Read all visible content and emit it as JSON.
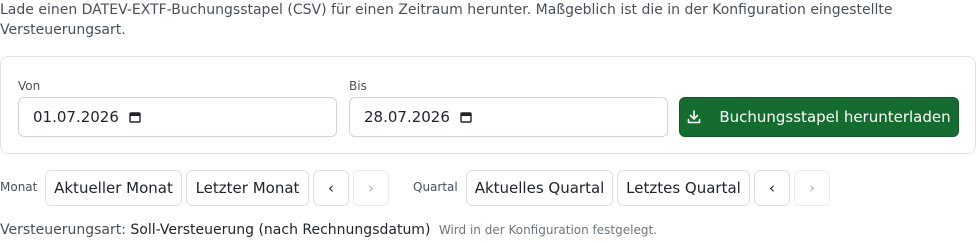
{
  "description": "Lade einen DATEV-EXTF-Buchungsstapel (CSV) für einen Zeitraum herunter. Maßgeblich ist die in der Konfiguration eingestellte Versteuerungsart.",
  "form": {
    "from_label": "Von",
    "from_value": "01.07.2026",
    "to_label": "Bis",
    "to_value": "28.07.2026",
    "download_label": "Buchungsstapel herunterladen"
  },
  "presets": {
    "month_label": "Monat",
    "current_month": "Aktueller Monat",
    "last_month": "Letzter Monat",
    "quarter_label": "Quartal",
    "current_quarter": "Aktuelles Quartal",
    "last_quarter": "Letztes Quartal",
    "prev_glyph": "‹",
    "next_glyph": "›"
  },
  "footer": {
    "label": "Versteuerungsart:",
    "value": "Soll-Versteuerung (nach Rechnungsdatum)",
    "note": "Wird in der Konfiguration festgelegt."
  },
  "colors": {
    "primary": "#146c2e",
    "border": "#dee2e6"
  },
  "icons": {
    "calendar": "calendar-icon",
    "download": "download-icon",
    "prev": "chevron-left-icon",
    "next": "chevron-right-icon"
  }
}
